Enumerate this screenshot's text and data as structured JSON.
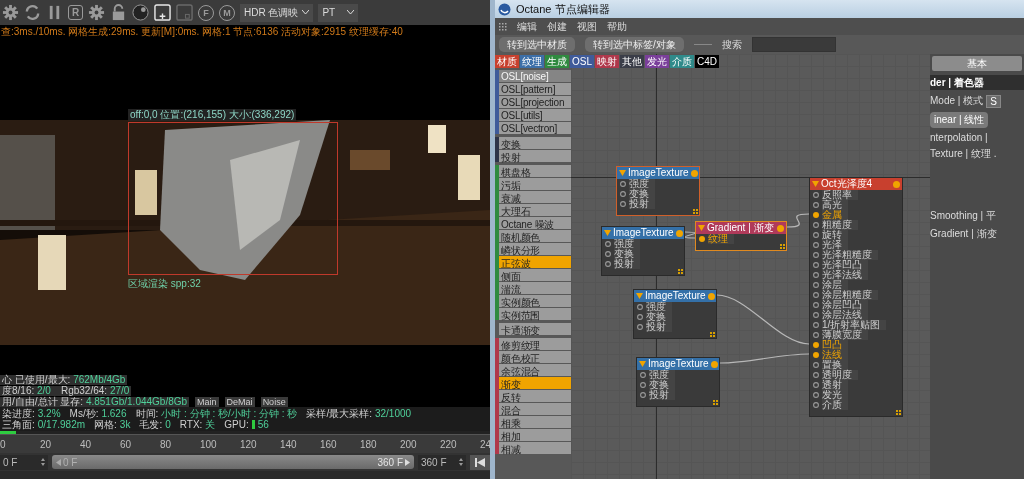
{
  "viewport": {
    "toolbar": [
      {
        "kind": "gear",
        "selected": false
      },
      {
        "kind": "refresh",
        "selected": false
      },
      {
        "kind": "pause",
        "selected": false
      },
      {
        "kind": "letter",
        "letter": "R",
        "selected": false
      },
      {
        "kind": "gear",
        "selected": false
      },
      {
        "kind": "lock",
        "selected": false
      },
      {
        "kind": "sphere",
        "selected": false
      },
      {
        "kind": "add-region",
        "selected": true
      },
      {
        "kind": "region",
        "selected": false
      },
      {
        "kind": "pin",
        "letter": "F",
        "selected": false
      },
      {
        "kind": "pin",
        "letter": "M",
        "selected": false
      }
    ],
    "tone_dropdown": "HDR 色调映",
    "mode_dropdown": "PT",
    "stats": "查:3ms./10ms. 网格生成:29ms. 更新[M]:0ms. 网格:1 节点:6136 活动对象:2915 纹理缓存:40",
    "region": {
      "header": "off:0,0 位置:(216,155) 大小:(336,292)",
      "footer": "区域渲染 spp:32"
    },
    "info_rows": [
      [
        {
          "label": "心 已使用/最大:",
          "value": "762Mb/4Gb"
        }
      ],
      [
        {
          "label": "度8/16:",
          "value": "2/0"
        },
        {
          "label": "Rgb32/64:",
          "value": "27/0"
        }
      ],
      [
        {
          "label": "用/自由/总计 显存:",
          "value": "4.851Gb/1.044Gb/8Gb"
        }
      ]
    ],
    "channel_tabs": [
      "Main",
      "DeMai",
      "Noise"
    ],
    "status": [
      {
        "kind": "text",
        "label": "染进度:",
        "value": "3.2%"
      },
      {
        "kind": "text",
        "label": "Ms/秒:",
        "value": "1.626"
      },
      {
        "kind": "text",
        "label": "时间:",
        "value": "小时 : 分钟 : 秒/小时 : 分钟 : 秒"
      },
      {
        "kind": "text",
        "label": "采样/最大采样:",
        "value": "32/1000"
      },
      {
        "kind": "text",
        "label": "三角面:",
        "value": "0/17.982m"
      },
      {
        "kind": "text",
        "label": "网格:",
        "value": "3k"
      },
      {
        "kind": "text",
        "label": "毛发:",
        "value": "0"
      },
      {
        "kind": "text",
        "label": "RTX:",
        "value": "关"
      },
      {
        "kind": "gpu",
        "label": "GPU:",
        "value": "56"
      }
    ],
    "progress": {
      "level": 0.032
    },
    "ruler": [
      "0",
      "20",
      "40",
      "60",
      "80",
      "100",
      "120",
      "140",
      "160",
      "180",
      "200",
      "220",
      "24"
    ],
    "frames": {
      "start": "0 F",
      "slider_start": "0 F",
      "slider_end": "360 F",
      "end": "360 F"
    }
  },
  "editor": {
    "title": "Octane 节点编辑器",
    "menu": [
      "编辑",
      "创建",
      "视图",
      "帮助"
    ],
    "buttons": [
      "转到选中材质",
      "转到选中标签/对象"
    ],
    "search_label": "搜索",
    "categories": [
      {
        "label": "材质",
        "color": "#c8402e"
      },
      {
        "label": "纹理",
        "color": "#3d6fa8"
      },
      {
        "label": "生成",
        "color": "#2f8a3f"
      },
      {
        "label": "OSL",
        "color": "#3f5b9a"
      },
      {
        "label": "映射",
        "color": "#b0384b"
      },
      {
        "label": "其他",
        "color": "#3a3d48"
      },
      {
        "label": "发光",
        "color": "#7a3f9a"
      },
      {
        "label": "介质",
        "color": "#2f8a8a"
      },
      {
        "label": "C4D",
        "color": "#000000"
      }
    ],
    "node_groups": [
      {
        "color": "#3f5b9a",
        "items": [
          {
            "label": "OSL[noise]",
            "selected": false,
            "disabled": true
          },
          {
            "label": "OSL[pattern]",
            "selected": false,
            "disabled": false
          },
          {
            "label": "OSL[projection",
            "selected": false,
            "disabled": false
          },
          {
            "label": "OSL[utils]",
            "selected": false,
            "disabled": false
          },
          {
            "label": "OSL[vectron]",
            "selected": false,
            "disabled": false
          }
        ]
      },
      {
        "color": "#2e3448",
        "items": [
          {
            "label": "变换",
            "selected": false,
            "disabled": false
          },
          {
            "label": "投射",
            "selected": false,
            "disabled": false
          }
        ]
      },
      {
        "color": "#2f8a3f",
        "items": [
          {
            "label": "棋盘格",
            "selected": false,
            "disabled": false
          },
          {
            "label": "污垢",
            "selected": false,
            "disabled": false
          },
          {
            "label": "衰减",
            "selected": false,
            "disabled": false
          },
          {
            "label": "大理石",
            "selected": false,
            "disabled": false
          },
          {
            "label": "Octane 噪波",
            "selected": false,
            "disabled": false
          },
          {
            "label": "随机颜色",
            "selected": false,
            "disabled": false
          },
          {
            "label": "嶙状分形",
            "selected": false,
            "disabled": false
          },
          {
            "label": "正弦波",
            "selected": true,
            "disabled": false
          },
          {
            "label": "侧面",
            "selected": false,
            "disabled": false
          },
          {
            "label": "湍流",
            "selected": false,
            "disabled": false
          },
          {
            "label": "实例颜色",
            "selected": false,
            "disabled": false
          },
          {
            "label": "实例范围",
            "selected": false,
            "disabled": false
          }
        ]
      },
      {
        "items": [
          {
            "label": "卡通渐变",
            "selected": false,
            "disabled": false
          }
        ]
      },
      {
        "color": "#b0384b",
        "items": [
          {
            "label": "修剪纹理",
            "selected": false,
            "disabled": false
          },
          {
            "label": "颜色校正",
            "selected": false,
            "disabled": false
          },
          {
            "label": "余弦混合",
            "selected": false,
            "disabled": false
          },
          {
            "label": "渐变",
            "selected": true,
            "disabled": false
          },
          {
            "label": "反转",
            "selected": false,
            "disabled": false
          },
          {
            "label": "混合",
            "selected": false,
            "disabled": false
          },
          {
            "label": "相乘",
            "selected": false,
            "disabled": false
          },
          {
            "label": "相加",
            "selected": false,
            "disabled": false
          },
          {
            "label": "相减",
            "selected": false,
            "disabled": false
          }
        ]
      }
    ],
    "nodes": [
      {
        "title": "ImageTexture",
        "selected": true,
        "ports": [
          {
            "label": "强度",
            "connected": false
          },
          {
            "label": "变换",
            "connected": false
          },
          {
            "label": "投射",
            "connected": false
          }
        ]
      },
      {
        "title": "ImageTexture",
        "selected": false,
        "ports": [
          {
            "label": "强度",
            "connected": false
          },
          {
            "label": "变换",
            "connected": false
          },
          {
            "label": "投射",
            "connected": false
          }
        ]
      },
      {
        "kind": "gradient",
        "title": "Gradient | 渐变",
        "selected": true,
        "ports": [
          {
            "label": "纹理",
            "connected": true
          }
        ]
      },
      {
        "title": "ImageTexture",
        "selected": false,
        "ports": [
          {
            "label": "强度",
            "connected": false
          },
          {
            "label": "变换",
            "connected": false
          },
          {
            "label": "投射",
            "connected": false
          }
        ]
      },
      {
        "title": "ImageTexture",
        "selected": false,
        "ports": [
          {
            "label": "强度",
            "connected": false
          },
          {
            "label": "变换",
            "connected": false
          },
          {
            "label": "投射",
            "connected": false
          }
        ]
      },
      {
        "kind": "material",
        "title": "Oct光泽度4",
        "selected": false,
        "ports": [
          {
            "label": "反照率",
            "connected": false
          },
          {
            "label": "高光",
            "connected": false
          },
          {
            "label": "金属",
            "connected": true
          },
          {
            "label": "粗糙度",
            "connected": false
          },
          {
            "label": "旋转",
            "connected": false
          },
          {
            "label": "光泽",
            "connected": false
          },
          {
            "label": "光泽粗糙度",
            "connected": false
          },
          {
            "label": "光泽凹凸",
            "connected": false
          },
          {
            "label": "光泽法线",
            "connected": false
          },
          {
            "label": "涂层",
            "connected": false
          },
          {
            "label": "涂层粗糙度",
            "connected": false
          },
          {
            "label": "涂层凹凸",
            "connected": false
          },
          {
            "label": "涂层法线",
            "connected": false
          },
          {
            "label": "1/折射率贴图",
            "connected": false
          },
          {
            "label": "薄膜宽度",
            "connected": false
          },
          {
            "label": "凹凸",
            "connected": true
          },
          {
            "label": "法线",
            "connected": true
          },
          {
            "label": "置换",
            "connected": false
          },
          {
            "label": "透明度",
            "connected": false
          },
          {
            "label": "透射",
            "connected": false
          },
          {
            "label": "发光",
            "connected": false
          },
          {
            "label": "介质",
            "connected": false
          }
        ]
      }
    ],
    "properties": {
      "tab": "基本",
      "header": "der | 着色器",
      "rows": [
        {
          "kind": "select",
          "label": "Mode | 模式",
          "value": "S"
        },
        {
          "kind": "button",
          "label": "inear | 线性"
        },
        {
          "kind": "text",
          "label": "nterpolation |"
        },
        {
          "kind": "text",
          "label": "Texture | 纹理 ."
        }
      ],
      "rows_lower": [
        "Smoothing | 平",
        "Gradient | 渐变"
      ]
    }
  }
}
